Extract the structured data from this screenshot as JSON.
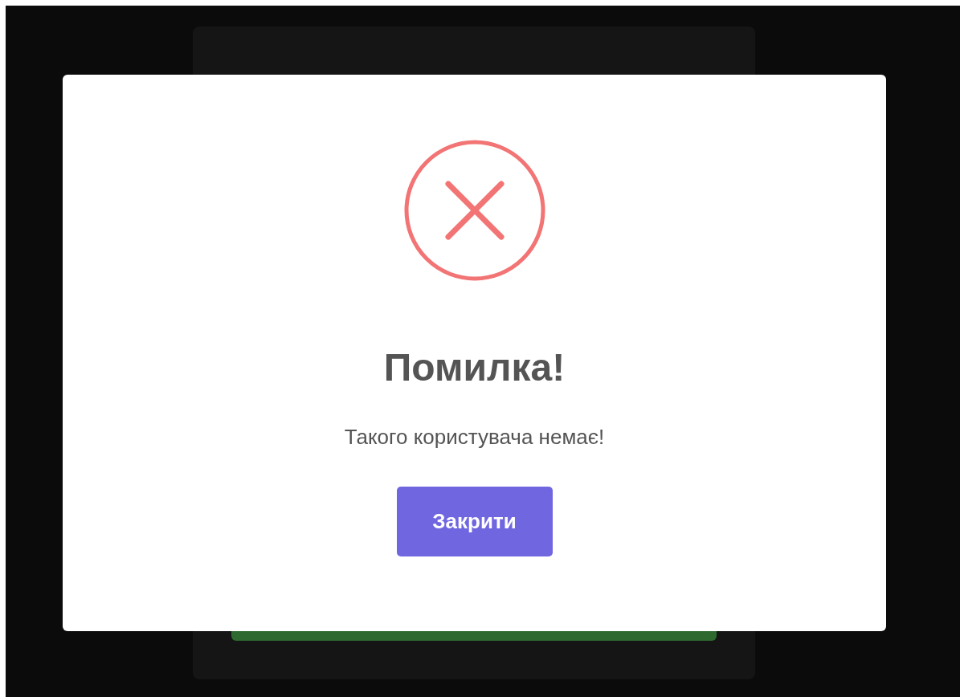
{
  "dialog": {
    "kind": "error",
    "title": "Помилка!",
    "message": "Такого користувача немає!",
    "button": "Закрити"
  }
}
